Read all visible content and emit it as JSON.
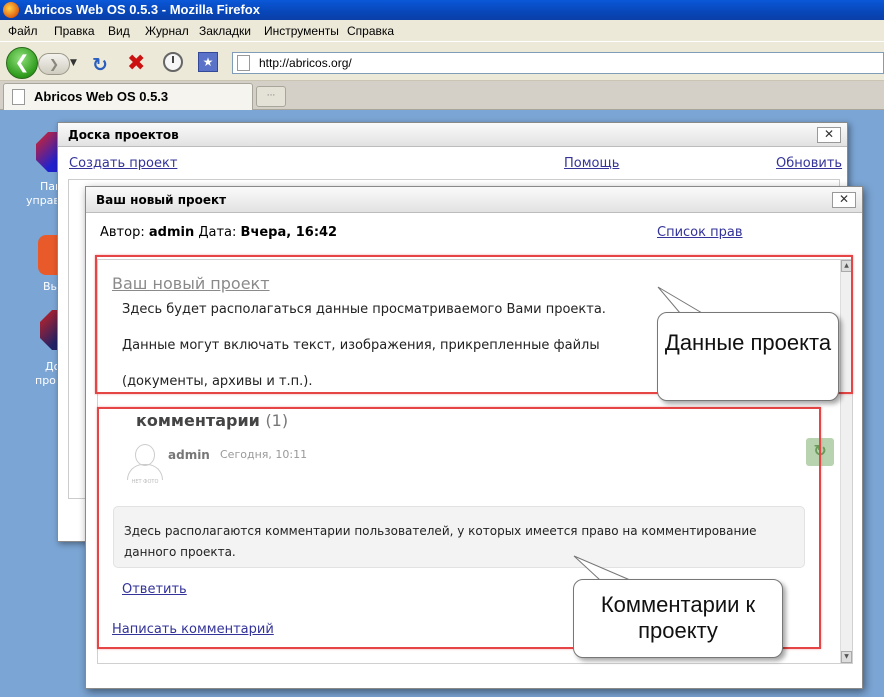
{
  "browser": {
    "window_title": "Abricos Web OS 0.5.3 - Mozilla Firefox",
    "menu": [
      "Файл",
      "Правка",
      "Вид",
      "Журнал",
      "Закладки",
      "Инструменты",
      "Справка"
    ],
    "url": "http://abricos.org/",
    "tab_title": "Abricos Web OS 0.5.3"
  },
  "desktop": {
    "labels": [
      "Пан",
      "управ",
      "Вы",
      "До",
      "про"
    ]
  },
  "board_window": {
    "title": "Доска проектов",
    "create_link": "Создать проект",
    "help_link": "Помощь",
    "refresh_link": "Обновить",
    "close_label": "✕"
  },
  "project_window": {
    "title": "Ваш новый проект",
    "close_label": "✕",
    "author_label": "Автор:",
    "author": "admin",
    "date_label": "Дата:",
    "date": "Вчера, 16:42",
    "rights_link": "Список прав",
    "project_title": "Ваш новый проект",
    "paragraphs": [
      "Здесь будет располагаться данные просматриваемого Вами проекта.",
      "Данные могут включать текст, изображения, прикрепленные файлы",
      "(документы, архивы и т.п.)."
    ],
    "comments_heading": "комментарии",
    "comments_count": "(1)",
    "comment": {
      "author": "admin",
      "time": "Сегодня, 10:11",
      "avatar_text": "НЕТ ФОТО",
      "text": "Здесь располагаются комментарии пользователей, у которых имеется право на комментирование данного проекта."
    },
    "reply_link": "Ответить",
    "write_comment_link": "Написать комментарий"
  },
  "annotations": {
    "callout_data": "Данные проекта",
    "callout_comments": "Комментарии к проекту"
  },
  "colors": {
    "annotation_red": "#e64545",
    "link": "#333399"
  }
}
